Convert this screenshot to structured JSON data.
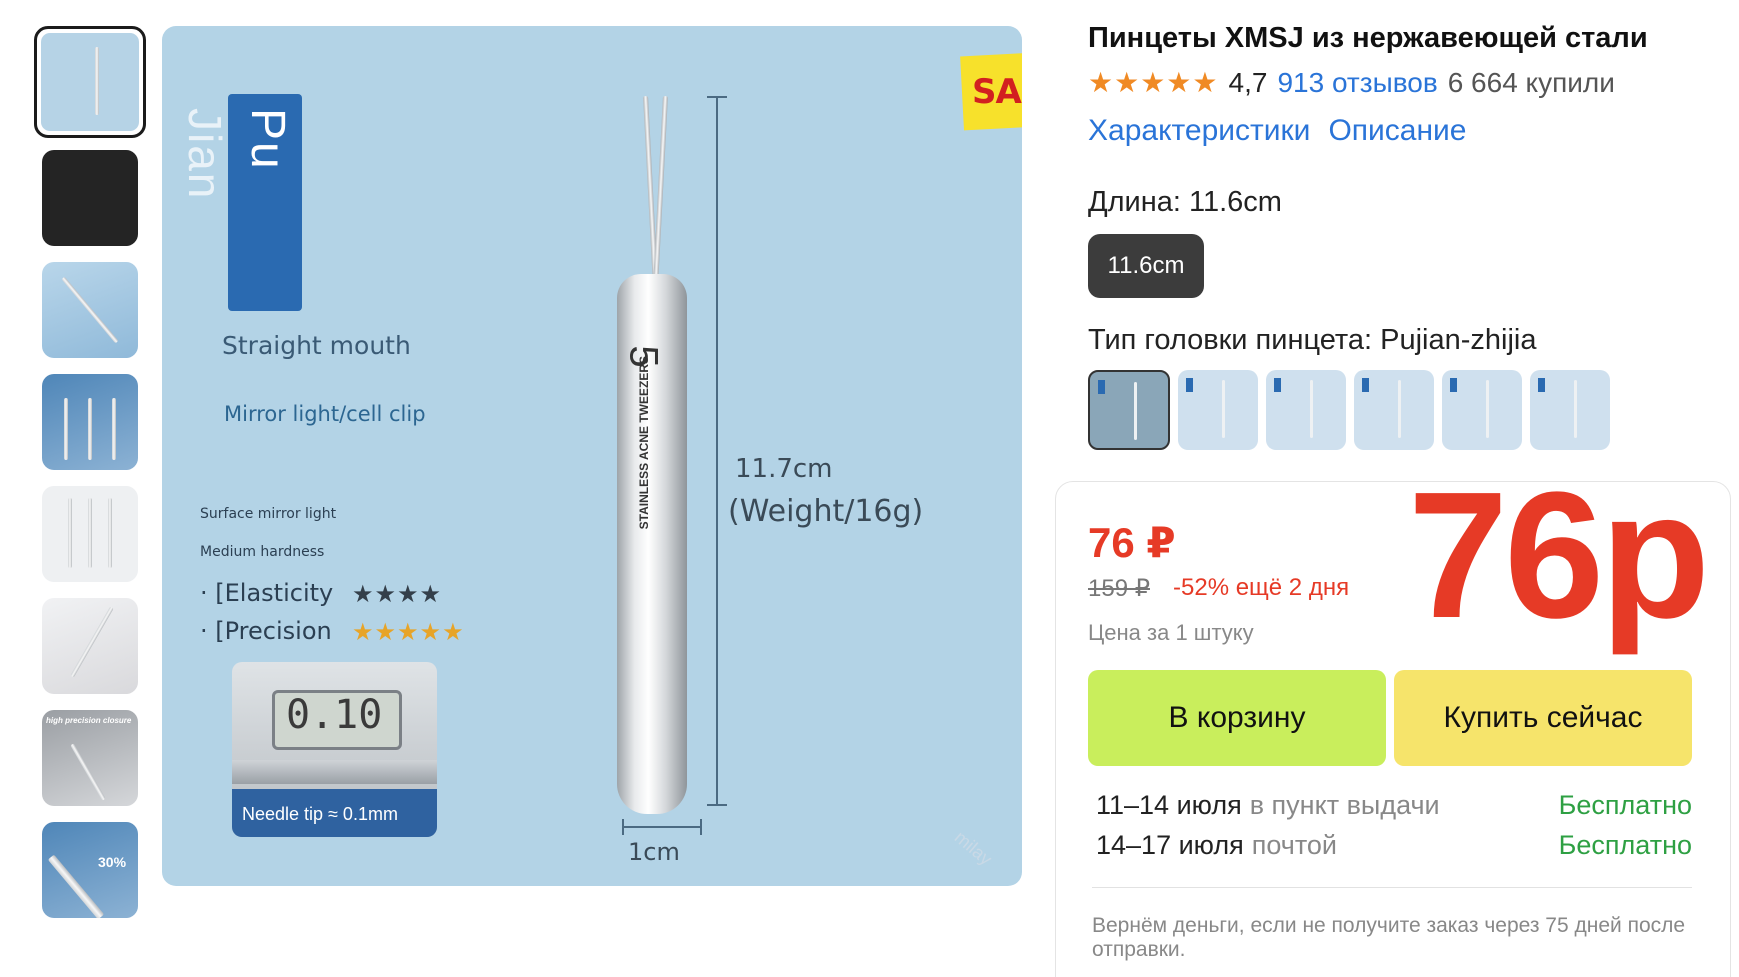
{
  "gallery": {
    "thumbnails": [
      {
        "name": "thumbnail-1",
        "selected": true
      },
      {
        "name": "thumbnail-2",
        "selected": false
      },
      {
        "name": "thumbnail-3",
        "selected": false
      },
      {
        "name": "thumbnail-4",
        "selected": false
      },
      {
        "name": "thumbnail-5",
        "selected": false
      },
      {
        "name": "thumbnail-6",
        "selected": false
      },
      {
        "name": "thumbnail-7",
        "selected": false,
        "caption": "high precision closure"
      },
      {
        "name": "thumbnail-8",
        "selected": false,
        "caption": "30%"
      }
    ],
    "main_image": {
      "brand_vertical": "Pu",
      "brand_vertical_2": "Jian",
      "feature_1": "Straight mouth",
      "feature_2": "Mirror light/cell clip",
      "feature_3": "Surface mirror light",
      "feature_4": "Medium hardness",
      "feature_5": "· [Elasticity",
      "feature_6": "· [Precision",
      "elasticity_stars": "★★★★",
      "precision_stars": "★★★★★",
      "caliper_reading": "0.10",
      "needle_tip": "Needle tip ≈ 0.1mm",
      "tweezer_number": "5",
      "tweezer_engraving": "STAINLESS ACNE TWEEZERS",
      "length_dimension": "11.7cm",
      "weight": "(Weight/16g)",
      "width_dimension": "1cm",
      "sale_tag": "SALE",
      "watermark": "milay"
    }
  },
  "product": {
    "title": "Пинцеты XMSJ из нержавеющей стали",
    "rating_stars": "★★★★★",
    "rating_value": "4,7",
    "reviews": "913 отзывов",
    "bought": "6 664 купили",
    "tabs": [
      "Характеристики",
      "Описание"
    ],
    "length_label": "Длина: 11.6cm",
    "length_option": "11.6cm",
    "head_type_label": "Тип головки пинцета: Pujian-zhijia",
    "head_variants_count": 6
  },
  "pricing": {
    "current": "76 ₽",
    "old": "159 ₽",
    "discount": "-52% ещё 2 дня",
    "per_unit": "Цена за 1 штуку",
    "big_price": "76р",
    "add_to_cart": "В корзину",
    "buy_now": "Купить сейчас",
    "delivery": [
      {
        "date": "11–14 июля",
        "method": "в пункт выдачи",
        "cost": "Бесплатно"
      },
      {
        "date": "14–17 июля",
        "method": "почтой",
        "cost": "Бесплатно"
      }
    ],
    "refund_note": "Вернём деньги, если не получите заказ через 75 дней после отправки."
  },
  "colors": {
    "accent_price": "#e63a26",
    "link": "#2a74d8",
    "cart_button": "#c9ee5c",
    "buy_button": "#f6e46b",
    "free_delivery": "#2ea043",
    "rating_star": "#f08a24"
  }
}
